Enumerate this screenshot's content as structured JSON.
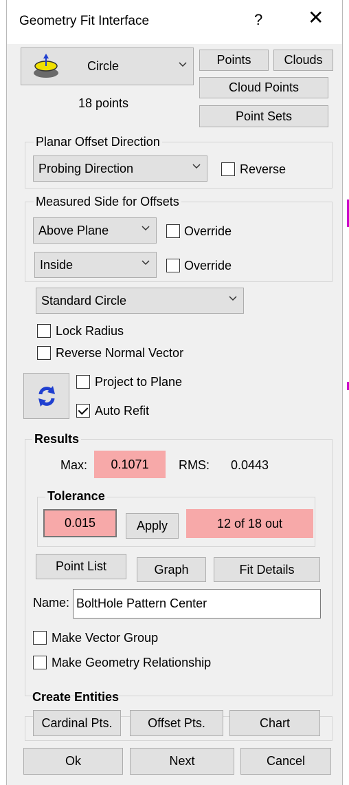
{
  "window": {
    "title": "Geometry Fit Interface",
    "help_label": "?",
    "close_label": "✕"
  },
  "geometry": {
    "shape_label": "Circle",
    "point_count": "18 points",
    "buttons": {
      "points": "Points",
      "clouds": "Clouds",
      "cloud_points": "Cloud Points",
      "point_sets": "Point Sets"
    }
  },
  "planar_offset": {
    "group_label": "Planar Offset Direction",
    "selected": "Probing Direction",
    "reverse_label": "Reverse",
    "reverse_checked": false
  },
  "measured_side": {
    "group_label": "Measured Side for Offsets",
    "side_selected": "Above Plane",
    "side_override_label": "Override",
    "inside_selected": "Inside",
    "inside_override_label": "Override"
  },
  "fit_type": {
    "selected": "Standard Circle"
  },
  "options": {
    "lock_radius": "Lock Radius",
    "reverse_normal": "Reverse Normal Vector",
    "project_to_plane": "Project to Plane",
    "auto_refit": "Auto Refit",
    "auto_refit_checked": true
  },
  "results": {
    "group_label": "Results",
    "max_label": "Max:",
    "max_value": "0.1071",
    "rms_label": "RMS:",
    "rms_value": "0.0443",
    "tolerance": {
      "group_label": "Tolerance",
      "value": "0.015",
      "apply_label": "Apply",
      "out_status": "12 of 18 out"
    },
    "buttons": {
      "point_list": "Point List",
      "graph": "Graph",
      "fit_details": "Fit Details"
    },
    "name_label": "Name:",
    "name_value": "BoltHole Pattern Center",
    "make_vector_group": "Make Vector Group",
    "make_geometry_relationship": "Make Geometry Relationship"
  },
  "create_entities": {
    "group_label": "Create Entities",
    "cardinal": "Cardinal Pts.",
    "offset": "Offset Pts.",
    "chart": "Chart"
  },
  "footer": {
    "ok": "Ok",
    "next": "Next",
    "cancel": "Cancel"
  },
  "colors": {
    "highlight": "#f7a9a9",
    "refit_icon": "#1f3fd0",
    "shape_icon": "#f0e000"
  }
}
